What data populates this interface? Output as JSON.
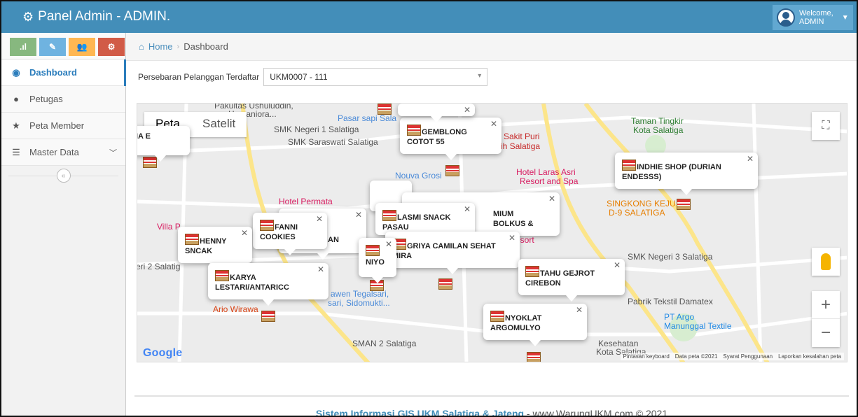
{
  "app": {
    "title": "Panel Admin - ADMIN."
  },
  "user": {
    "welcome": "Welcome,",
    "name": "ADMIN"
  },
  "sidebar": {
    "items": [
      {
        "label": "Dashboard"
      },
      {
        "label": "Petugas"
      },
      {
        "label": "Peta Member"
      },
      {
        "label": "Master Data"
      }
    ]
  },
  "breadcrumb": {
    "home": "Home",
    "current": "Dashboard"
  },
  "filter": {
    "label": "Persebaran Pelanggan Terdaftar",
    "selected": "UKM0007 - 111"
  },
  "map": {
    "type_map": "Peta",
    "type_satellite": "Satelit",
    "google": "Google",
    "attribution": [
      "Pintasan keyboard",
      "Data peta ©2021",
      "Syarat Penggunaan",
      "Laporkan kesalahan peta"
    ],
    "places": {
      "p1": "Pakultas Ushuluddin,",
      "p2": "n Humaniora...",
      "p3": "SMK Negeri 1 Salatiga",
      "p4": "SMK Saraswati Salatiga",
      "p5": "Pasar sapi Sala",
      "p6": "Taman Tingkir",
      "p7": "Kota Salatiga",
      "p8": "h Sakit Puri",
      "p9": "sih Salatiga",
      "p10": "Nouva Grosi",
      "p11": "Hotel Laras Asri",
      "p12": "Resort and Spa",
      "p13": "Hotel Permata",
      "p14": "Villa P",
      "p15": "SINGKONG KEJU",
      "p16": "D-9 SALATIGA",
      "p17": "SMK Negeri 3 Salatiga",
      "p18": "Pabrik Tekstil Damatex",
      "p19": "PT Argo",
      "p20": "Manunggal Textile",
      "p21": "SMAN 2 Salatiga",
      "p22": "Kesehatan",
      "p23": "Kota Salatiga",
      "p24": "Ario Wirawa",
      "p25": "awen Tegalsari,",
      "p26": "sari, Sidomukti...",
      "p27": "eri 2 Salatig",
      "p28": "esort"
    },
    "info_windows": {
      "w1": "GEMBLONG COTOT 55",
      "w2": "INDHIE SHOP (DURIAN ENDESSS)",
      "w3": "MIUM BOLKUS &",
      "w4": "LASMI SNACK PASAU",
      "w5": "FANNI COOKIES",
      "w6": "AN",
      "w7": "HENNY SNCAK",
      "w8": "KARYA LESTARI/ANTARICC",
      "w9": "NIYO",
      "w10": "GRIYA CAMILAN SEHAT MIRA",
      "w11": "TAHU GEJROT CIREBON",
      "w12": "NYOKLAT ARGOMULYO",
      "w13": "IA E"
    }
  },
  "footer": {
    "brand": "Sistem Informasi GIS UKM Salatiga & Jateng",
    "rest": " - www.WarungUKM.com © 2021"
  },
  "colors": {
    "header": "#438eb9",
    "accent": "#2b7dbc",
    "shortcut_green": "#87b87f",
    "shortcut_blue": "#6fb3e0",
    "shortcut_orange": "#ffb752",
    "shortcut_red": "#d15b47"
  }
}
